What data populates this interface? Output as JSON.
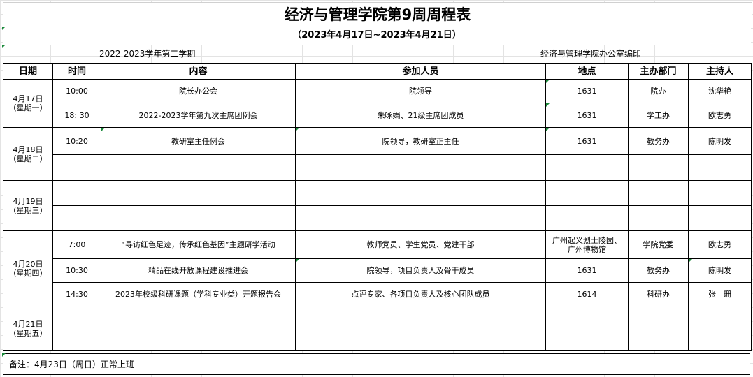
{
  "title": "经济与管理学院第9周周程表",
  "subtitle": "（2023年4月17日~2023年4月21日）",
  "semester": "2022-2023学年第二学期",
  "compiled_by": "经济与管理学院办公室编印",
  "headers": {
    "date": "日期",
    "time": "时间",
    "content": "内容",
    "participants": "参加人员",
    "location": "地点",
    "organizer": "主办部门",
    "host": "主持人"
  },
  "days": [
    {
      "date": "4月17日",
      "weekday": "（星期一）"
    },
    {
      "date": "4月18日",
      "weekday": "（星期二）"
    },
    {
      "date": "4月19日",
      "weekday": "（星期三）"
    },
    {
      "date": "4月20日",
      "weekday": "（星期四）"
    },
    {
      "date": "4月21日",
      "weekday": "（星期五）"
    }
  ],
  "rows": [
    {
      "time": "10:00",
      "content": "院长办公会",
      "participants": "院领导",
      "location": "1631",
      "organizer": "院办",
      "host": "沈华艳"
    },
    {
      "time": "18: 30",
      "content": "2022-2023学年第九次主席团例会",
      "participants": "朱咏娟、21级主席团成员",
      "location": "1631",
      "organizer": "学工办",
      "host": "欧志勇"
    },
    {
      "time": "10:20",
      "content": "教研室主任例会",
      "participants": "院领导，教研室正主任",
      "location": "1631",
      "organizer": "教务办",
      "host": "陈明发"
    },
    {
      "time": "",
      "content": "",
      "participants": "",
      "location": "",
      "organizer": "",
      "host": ""
    },
    {
      "time": "",
      "content": "",
      "participants": "",
      "location": "",
      "organizer": "",
      "host": ""
    },
    {
      "time": "",
      "content": "",
      "participants": "",
      "location": "",
      "organizer": "",
      "host": ""
    },
    {
      "time": "7:00",
      "content": "“寻访红色足迹，传承红色基因”主题研学活动",
      "participants": "教师党员、学生党员、党建干部",
      "location_line1": "广州起义烈士陵园、",
      "location_line2": "广州博物馆",
      "organizer": "学院党委",
      "host": "欧志勇"
    },
    {
      "time": "10:30",
      "content": "精品在线开放课程建设推进会",
      "participants": "院领导，项目负责人及骨干成员",
      "location": "1631",
      "organizer": "教务办",
      "host": "陈明发"
    },
    {
      "time": "14:30",
      "content": "2023年校级科研课题（学科专业类）开题报告会",
      "participants": "点评专家、各项目负责人及核心团队成员",
      "location": "1614",
      "organizer": "科研办",
      "host": "张　珊"
    },
    {
      "time": "",
      "content": "",
      "participants": "",
      "location": "",
      "organizer": "",
      "host": ""
    },
    {
      "time": "",
      "content": "",
      "participants": "",
      "location": "",
      "organizer": "",
      "host": ""
    }
  ],
  "note": "备注：4月23日（周日）正常上班"
}
